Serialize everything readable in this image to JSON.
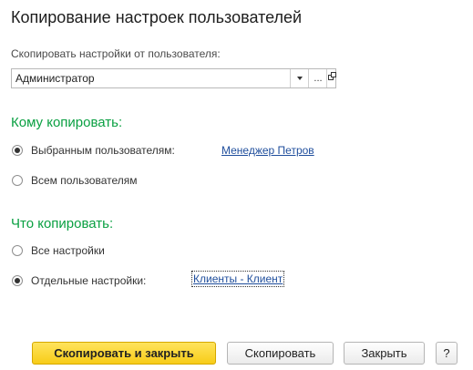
{
  "window": {
    "title": "Копирование настроек пользователей"
  },
  "source": {
    "label": "Скопировать настройки от пользователя:",
    "value": "Администратор",
    "more_button": "..."
  },
  "whom": {
    "heading": "Кому копировать:",
    "options": [
      {
        "label": "Выбранным пользователям:",
        "selected": true,
        "link": "Менеджер Петров"
      },
      {
        "label": "Всем пользователям",
        "selected": false
      }
    ]
  },
  "what": {
    "heading": "Что копировать:",
    "options": [
      {
        "label": "Все настройки",
        "selected": false
      },
      {
        "label": "Отдельные настройки:",
        "selected": true,
        "link": "Клиенты - Клиент"
      }
    ]
  },
  "buttons": {
    "copy_close": "Скопировать и закрыть",
    "copy": "Скопировать",
    "close": "Закрыть",
    "help": "?"
  },
  "colors": {
    "section_heading": "#0aa042",
    "link": "#1f4e9c",
    "primary_button": "#f7cc18"
  }
}
